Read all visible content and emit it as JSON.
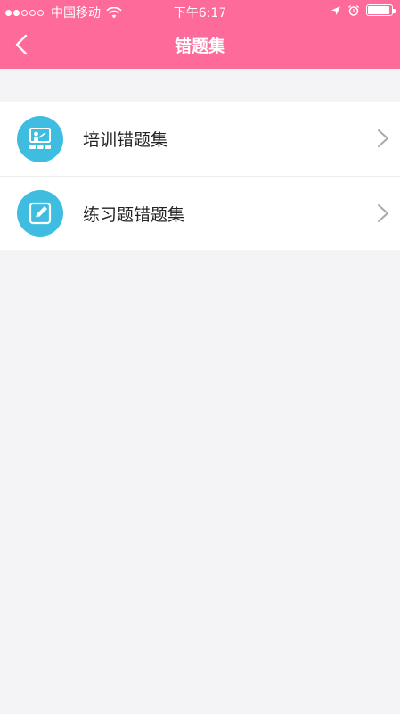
{
  "status_bar": {
    "carrier": "中国移动",
    "time": "下午6:17",
    "signal": {
      "filled": 2,
      "total": 5
    }
  },
  "nav": {
    "title": "错题集",
    "back_icon": "chevron-left-icon"
  },
  "items": [
    {
      "label": "培训错题集",
      "icon": "training-board-icon"
    },
    {
      "label": "练习题错题集",
      "icon": "edit-note-icon"
    }
  ],
  "colors": {
    "header": "#fe6a9a",
    "icon_bg": "#3fbde0",
    "background": "#f4f3f6"
  }
}
